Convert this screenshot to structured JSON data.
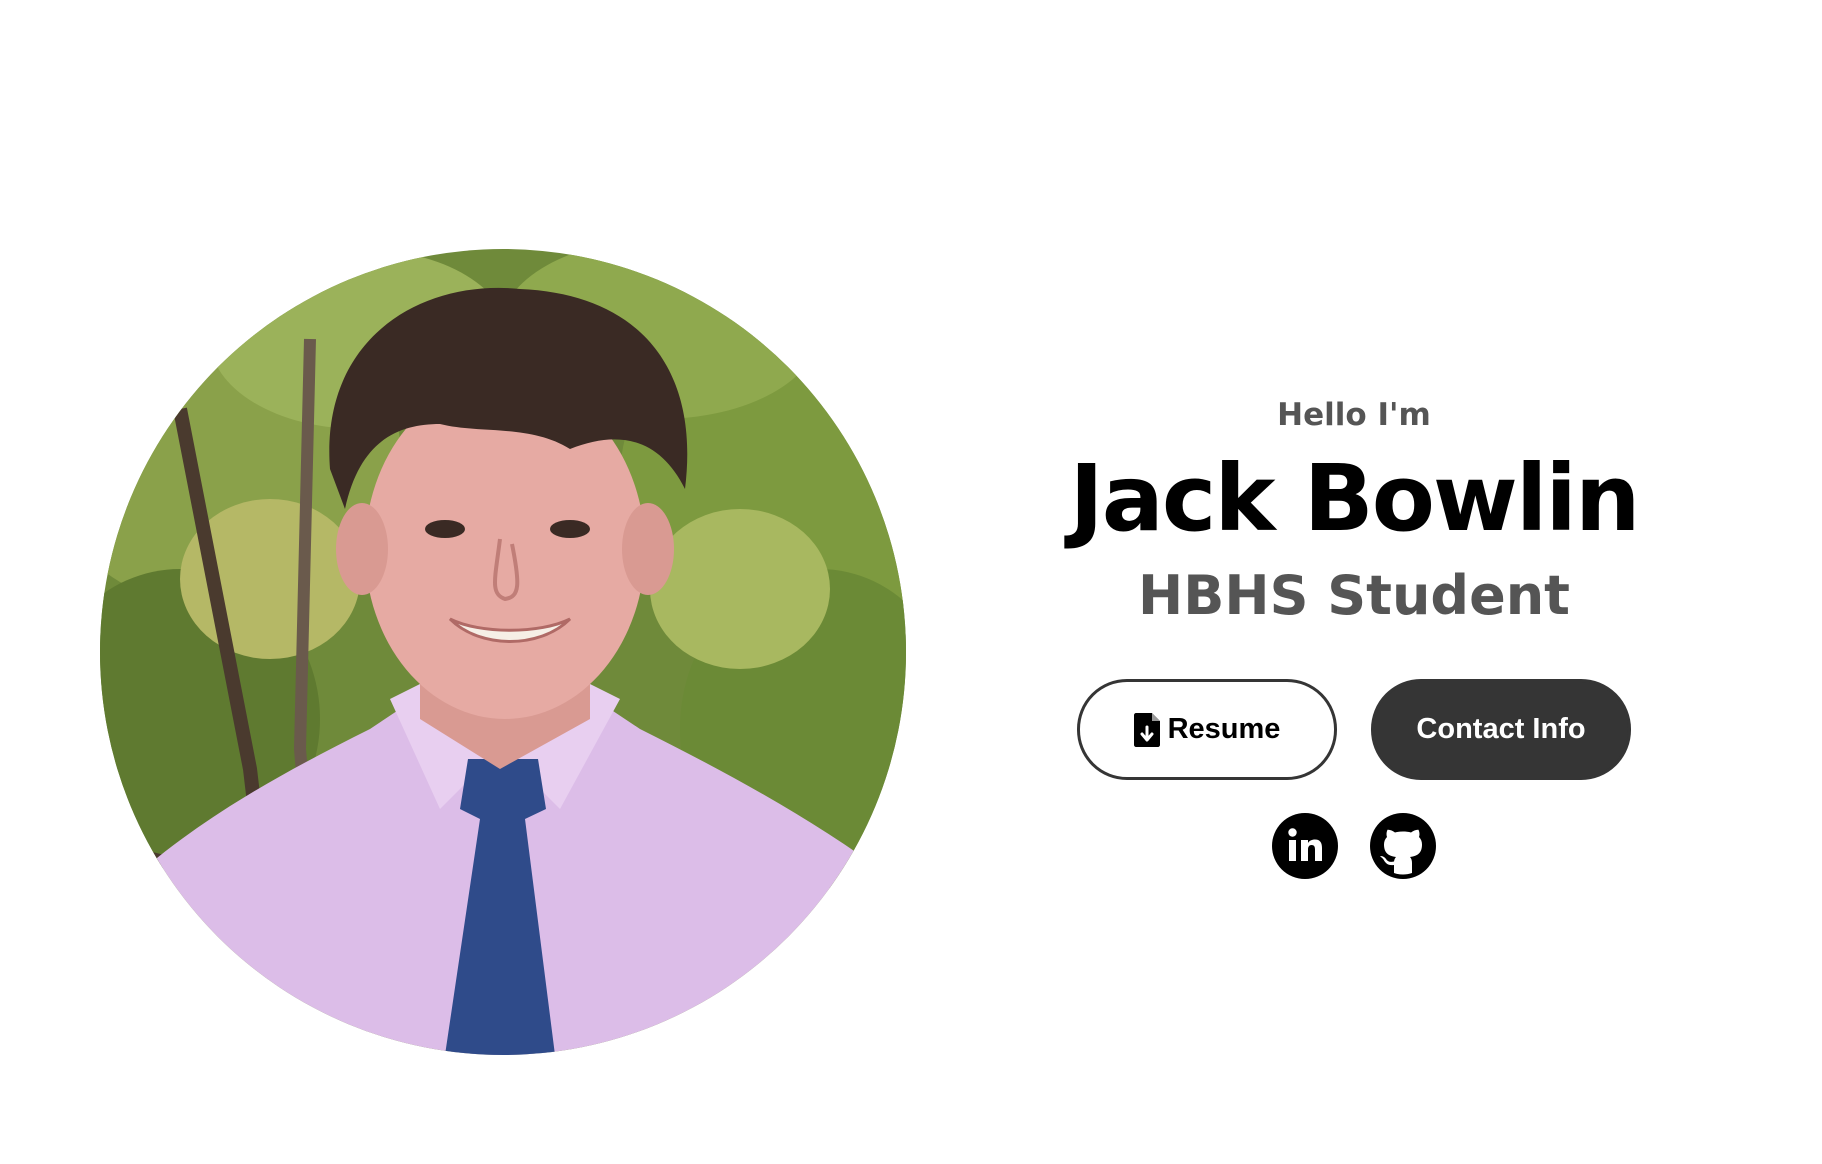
{
  "profile": {
    "photo_alt": "profile picture"
  },
  "intro": {
    "greeting": "Hello I'm",
    "name": "Jack Bowlin",
    "title": "HBHS Student"
  },
  "buttons": {
    "resume_label": "Resume",
    "resume_icon": "file-download-icon",
    "contact_label": "Contact Info"
  },
  "socials": [
    {
      "icon": "linkedin-icon",
      "alt": "My LinkedIn profile"
    },
    {
      "icon": "github-icon",
      "alt": "My Git profile"
    }
  ],
  "colors": {
    "background": "#ffffff",
    "text_primary": "#000000",
    "text_secondary": "#555555",
    "button_dark": "#353535"
  }
}
